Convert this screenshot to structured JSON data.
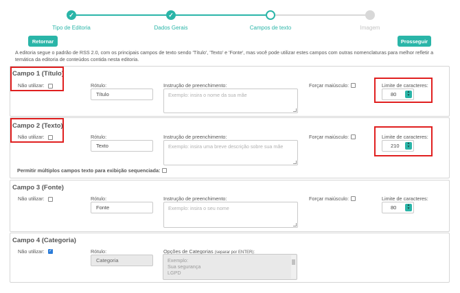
{
  "stepper": {
    "steps": [
      {
        "label": "Tipo de Editoria",
        "state": "done"
      },
      {
        "label": "Dados Gerais",
        "state": "done"
      },
      {
        "label": "Campos de texto",
        "state": "current"
      },
      {
        "label": "Imagem",
        "state": "todo"
      }
    ],
    "check_glyph": "✓"
  },
  "buttons": {
    "back": "Retornar",
    "next": "Prosseguir"
  },
  "intro": "A editoria segue o padrão de RSS 2.0, com os principais campos de texto sendo 'Título', 'Texto' e 'Fonte', mas você pode utilizar estes campos com outras nomenclaturas para melhor refletir a temática da editoria de conteúdos contida nesta editoria.",
  "labels": {
    "nao_utilizar": "Não utilizar:",
    "rotulo": "Rótulo:",
    "instrucao": "Instrução de preenchimento:",
    "forcar": "Forçar maiúsculo:",
    "limite": "Limite de caracteres:",
    "opcoes": "Opções de Categorias",
    "opcoes_hint": "(separar por ENTER):"
  },
  "campo1": {
    "title": "Campo 1 (Título)",
    "rotulo": "Título",
    "instrucao_placeholder": "Exemplo: insira o nome da sua mãe",
    "limite": "80"
  },
  "campo2": {
    "title": "Campo 2 (Texto)",
    "rotulo": "Texto",
    "instrucao_placeholder": "Exemplo: insira uma breve descrição sobre sua mãe",
    "limite": "210",
    "multiplos": "Permitir múltiplos campos texto para exibição sequenciada:"
  },
  "campo3": {
    "title": "Campo 3 (Fonte)",
    "rotulo": "Fonte",
    "instrucao_placeholder": "Exemplo: insira o seu nome",
    "limite": "80"
  },
  "campo4": {
    "title": "Campo 4 (Categoria)",
    "rotulo": "Categoria",
    "nao_utilizar_checked": true,
    "opcoes": [
      "Exemplo:",
      "Sua segurança",
      "LGPD"
    ]
  },
  "colors": {
    "accent": "#2ab5a8",
    "highlight": "#e01e1e",
    "checkbox_on": "#2a7bd8"
  },
  "icons": {
    "spinner": "spinner-icon",
    "step_done": "check-icon"
  }
}
